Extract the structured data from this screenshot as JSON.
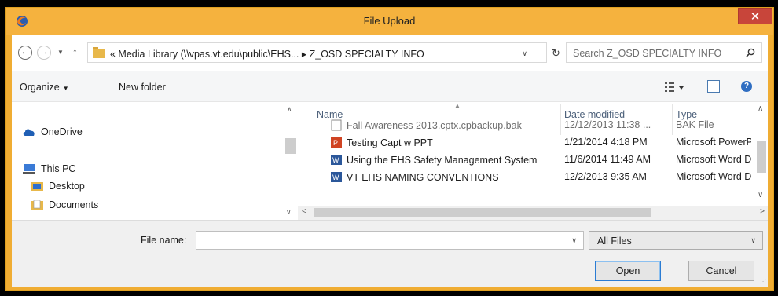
{
  "window": {
    "title": "File Upload",
    "close_label": "✕"
  },
  "address": {
    "path": "« Media Library (\\\\vpas.vt.edu\\public\\EHS... ▸ Z_OSD SPECIALTY INFO",
    "search_placeholder": "Search Z_OSD SPECIALTY INFO"
  },
  "toolbar": {
    "organize_label": "Organize",
    "new_folder_label": "New folder"
  },
  "nav": {
    "items": [
      {
        "label": "OneDrive",
        "icon": "cloud-icon"
      },
      {
        "label": "This PC",
        "icon": "computer-icon"
      },
      {
        "label": "Desktop",
        "icon": "desktop-folder-icon"
      },
      {
        "label": "Documents",
        "icon": "documents-folder-icon"
      }
    ]
  },
  "files": {
    "columns": [
      "Name",
      "Date modified",
      "Type"
    ],
    "rows": [
      {
        "name": "Fall Awareness 2013.cptx.cpbackup.bak",
        "date": "12/12/2013 11:38 ...",
        "type": "BAK File",
        "icon": "generic-file-icon"
      },
      {
        "name": "Testing Capt w PPT",
        "date": "1/21/2014 4:18 PM",
        "type": "Microsoft PowerP...",
        "icon": "powerpoint-file-icon"
      },
      {
        "name": "Using the EHS Safety Management System",
        "date": "11/6/2014 11:49 AM",
        "type": "Microsoft Word D...",
        "icon": "word-file-icon"
      },
      {
        "name": "VT EHS NAMING CONVENTIONS",
        "date": "12/2/2013 9:35 AM",
        "type": "Microsoft Word D...",
        "icon": "word-file-icon"
      }
    ]
  },
  "footer": {
    "file_name_label": "File name:",
    "file_name_value": "",
    "file_type": "All Files",
    "open_label": "Open",
    "cancel_label": "Cancel"
  },
  "colors": {
    "title_bar": "#f5b23e",
    "close_button": "#c8453a",
    "accent": "#2b7cd3"
  }
}
